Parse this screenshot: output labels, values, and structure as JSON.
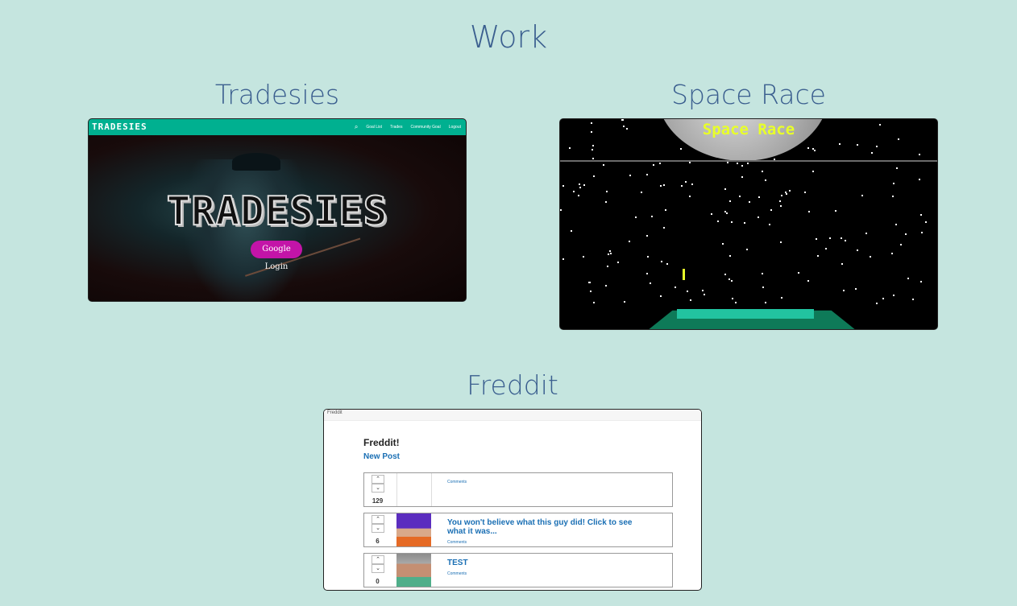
{
  "section_title": "Work",
  "projects": [
    {
      "title": "Tradesies",
      "screen": {
        "brand": "TRADESIES",
        "nav_links": [
          "Goal List",
          "Trades",
          "Community Goal",
          "Logout"
        ],
        "headline": "TRADESIES",
        "login_label": "Google Login"
      }
    },
    {
      "title": "Space Race",
      "screen": {
        "game_title": "Space Race"
      }
    },
    {
      "title": "Freddit",
      "screen": {
        "window_title": "Freddit",
        "heading": "Freddit!",
        "new_post": "New Post",
        "posts": [
          {
            "score": "129",
            "title": "",
            "comments": "Comments"
          },
          {
            "score": "6",
            "title": "You won't believe what this guy did! Click to see what it was...",
            "comments": "Comments"
          },
          {
            "score": "0",
            "title": "TEST",
            "comments": "Comments"
          }
        ]
      }
    }
  ],
  "colors": {
    "background": "#c5e5df",
    "heading": "#3b5f8f",
    "tradesies_nav": "#00b090",
    "login_button": "#c314a8",
    "space_title": "#e8ff29",
    "link": "#1a6fb4"
  }
}
